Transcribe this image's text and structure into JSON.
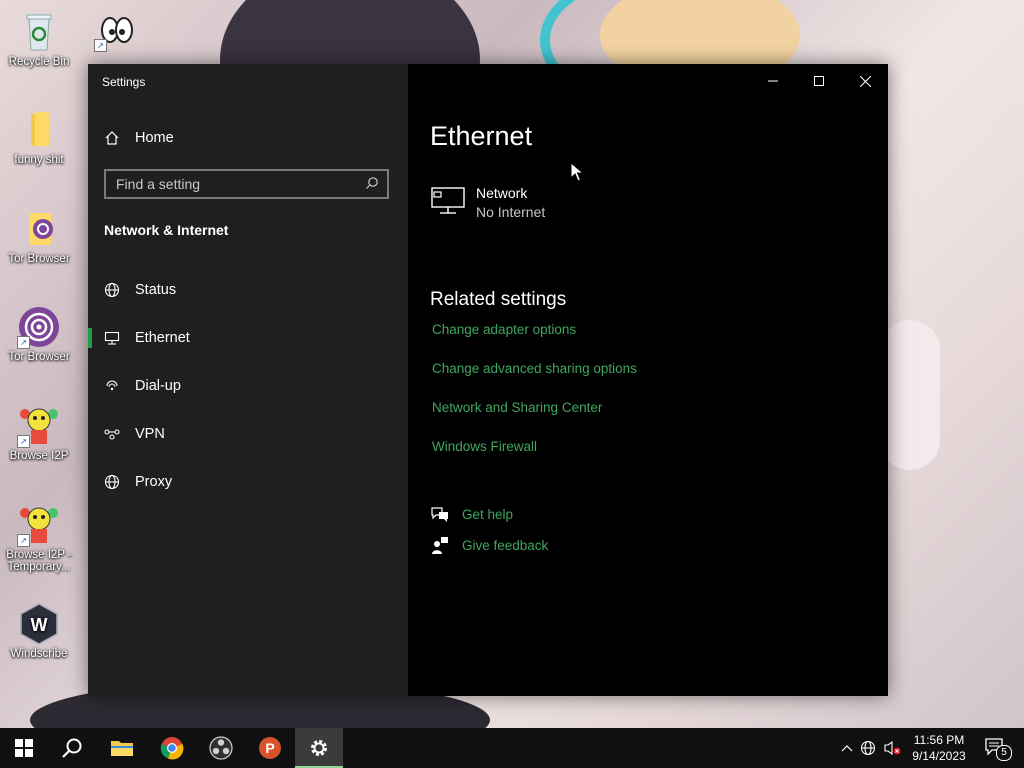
{
  "desktop": {
    "icons": [
      {
        "label": "Recycle Bin"
      },
      {
        "label": "funny shit"
      },
      {
        "label": "Tor Browser"
      },
      {
        "label": "Tor Browser"
      },
      {
        "label": "Browse I2P"
      },
      {
        "label": "Browse I2P - Temporary..."
      },
      {
        "label": "Windscribe"
      }
    ]
  },
  "window": {
    "title": "Settings",
    "home_label": "Home",
    "search_placeholder": "Find a setting",
    "section_title": "Network & Internet",
    "nav": [
      {
        "label": "Status",
        "icon": "globe-status-icon"
      },
      {
        "label": "Ethernet",
        "icon": "ethernet-icon",
        "active": true
      },
      {
        "label": "Dial-up",
        "icon": "dialup-icon"
      },
      {
        "label": "VPN",
        "icon": "vpn-icon"
      },
      {
        "label": "Proxy",
        "icon": "globe-icon"
      }
    ]
  },
  "main": {
    "page_title": "Ethernet",
    "network": {
      "name": "Network",
      "status": "No Internet"
    },
    "related_title": "Related settings",
    "links": [
      "Change adapter options",
      "Change advanced sharing options",
      "Network and Sharing Center",
      "Windows Firewall"
    ],
    "help": {
      "get_help": "Get help",
      "give_feedback": "Give feedback"
    }
  },
  "taskbar": {
    "time": "11:56 PM",
    "date": "9/14/2023",
    "notification_count": "5"
  },
  "colors": {
    "accent": "#3fa65f",
    "sidebar_bg": "#1f1f1f",
    "main_bg": "#000000",
    "taskbar_bg": "#101010"
  }
}
